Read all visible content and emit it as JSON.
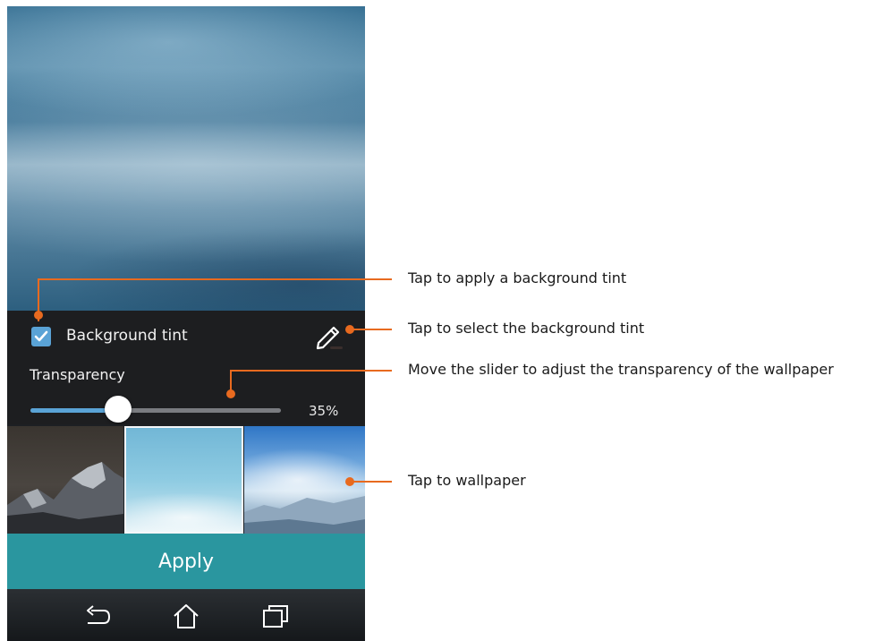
{
  "tint": {
    "label": "Background tint",
    "checked": true,
    "accent_color": "#5aa3d6",
    "edit_icon": "pencil-icon"
  },
  "transparency": {
    "label": "Transparency",
    "value_percent": 35,
    "value_text": "35%"
  },
  "thumbnails": [
    {
      "name": "mountain-peaks-dusk",
      "selected": false
    },
    {
      "name": "snow-field-blue",
      "selected": true
    },
    {
      "name": "snowy-mountain-sky",
      "selected": false
    }
  ],
  "apply": {
    "label": "Apply",
    "color": "#2a969f"
  },
  "nav": {
    "back_icon": "back-icon",
    "home_icon": "home-icon",
    "recent_icon": "recent-apps-icon"
  },
  "callouts": {
    "apply_tint": "Tap to apply a background tint",
    "select_tint": "Tap to select the background tint",
    "slider": "Move the slider to adjust the transparency of the wallpaper",
    "wallpaper": "Tap to wallpaper",
    "color": "#e86a1f"
  }
}
